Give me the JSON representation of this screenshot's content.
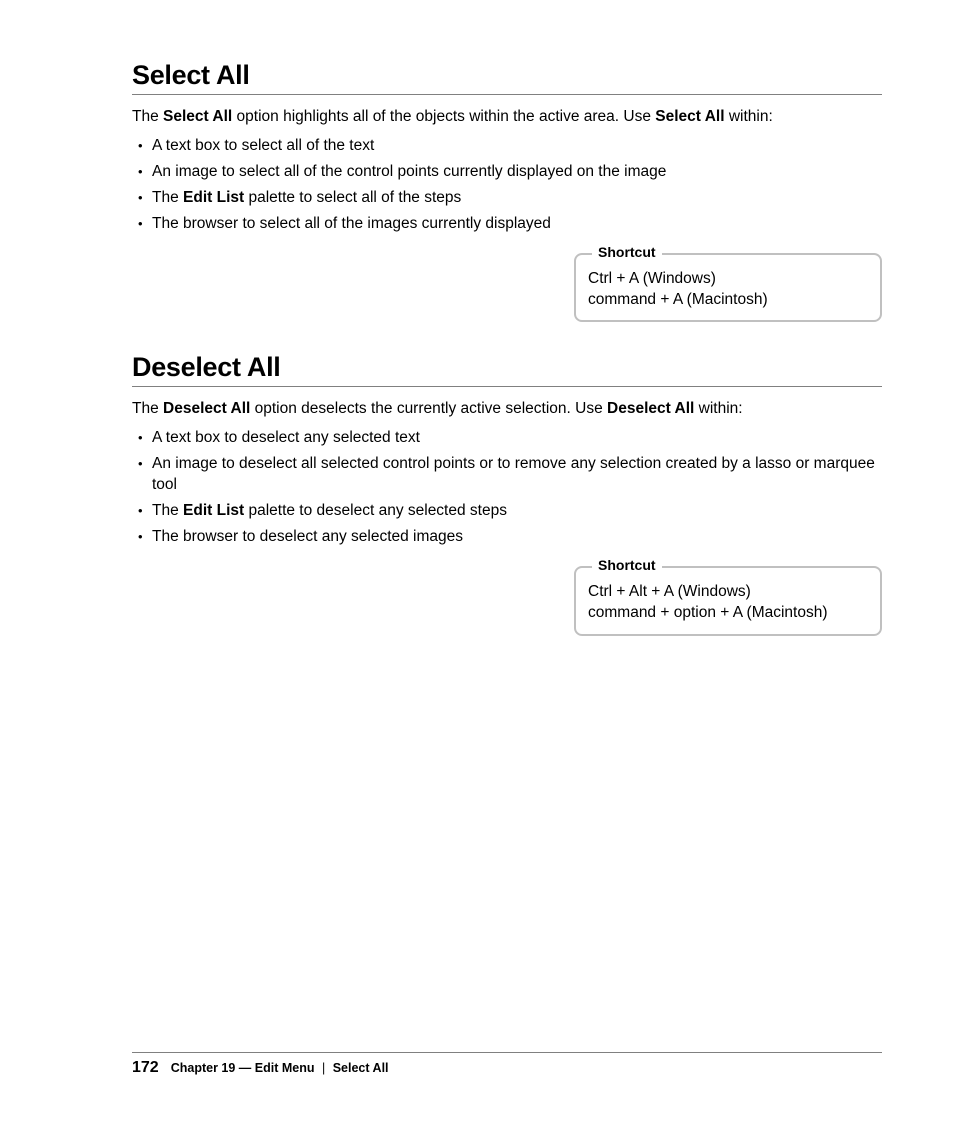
{
  "section1": {
    "title": "Select All",
    "intro_pre": "The ",
    "intro_bold1": "Select All",
    "intro_mid": " option highlights all of the objects within the active area. Use ",
    "intro_bold2": "Select All",
    "intro_post": " within:",
    "bullets": {
      "b1": "A text box to select all of the text",
      "b2": "An image to select all of the control points currently displayed on the image",
      "b3_pre": "The ",
      "b3_bold": "Edit List",
      "b3_post": " palette to select all of the steps",
      "b4": "The browser to select all of the images currently displayed"
    },
    "shortcut": {
      "label": "Shortcut",
      "line1": "Ctrl + A (Windows)",
      "line2": "command + A (Macintosh)"
    }
  },
  "section2": {
    "title": "Deselect All",
    "intro_pre": "The ",
    "intro_bold1": "Deselect All",
    "intro_mid": " option deselects the currently active selection. Use ",
    "intro_bold2": "Deselect All",
    "intro_post": " within:",
    "bullets": {
      "b1": "A text box to deselect any selected text",
      "b2": "An image to deselect all selected control points or to remove any selection created by a lasso or marquee tool",
      "b3_pre": "The ",
      "b3_bold": "Edit List",
      "b3_post": " palette to deselect any selected steps",
      "b4": "The browser to deselect any selected images"
    },
    "shortcut": {
      "label": "Shortcut",
      "line1": "Ctrl + Alt + A (Windows)",
      "line2": "command + option + A (Macintosh)"
    }
  },
  "footer": {
    "page": "172",
    "chapter": "Chapter 19 — Edit Menu",
    "sep": "|",
    "topic": "Select All"
  }
}
